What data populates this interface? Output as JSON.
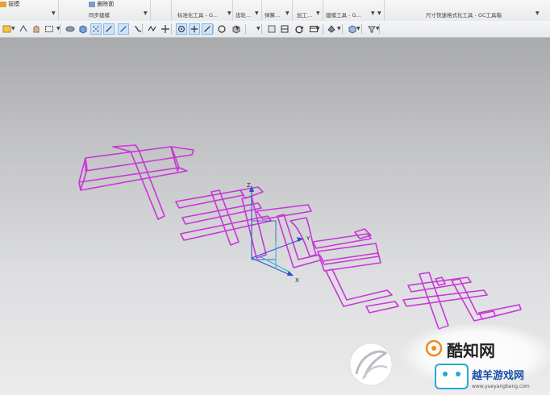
{
  "ribbon": {
    "left_label": "拔模",
    "item_label": "删除面",
    "groups": [
      {
        "label": "同步建模"
      },
      {
        "label": "标准化工具 - G..."
      },
      {
        "label": "齿轮..."
      },
      {
        "label": "弹簧..."
      },
      {
        "label": "加工..."
      },
      {
        "label": "建模工具 - G..."
      },
      {
        "label": "尺寸快速格式化工具 - GC工具箱"
      }
    ]
  },
  "toolbar": {
    "icons": [
      "snap-icon",
      "lasso-icon",
      "hand-icon",
      "box-select-icon",
      "view-icon",
      "solid-icon",
      "grid-icon",
      "line-icon",
      "curve-icon",
      "spline-icon",
      "wave-icon",
      "point-icon",
      "circle-icon",
      "plus-icon",
      "slash-icon",
      "rotate-icon",
      "shade-icon",
      "render-icon",
      "layer-icon",
      "refresh-icon",
      "table-icon",
      "fill-icon",
      "cube-icon",
      "filter-icon"
    ]
  },
  "viewport": {
    "axes": {
      "x_label": "X",
      "y_label": "Y",
      "z_label": "Z"
    },
    "colors": {
      "wire": "#c936d9",
      "wire_dark": "#8a1fa5",
      "axis_blue": "#2f4ccf",
      "axis_cyan": "#20b8c8"
    }
  },
  "watermark": {
    "brand_cn": "酷知网",
    "brand2_cn": "越羊游戏网",
    "brand2_url": "www.yueyangbang.com"
  }
}
